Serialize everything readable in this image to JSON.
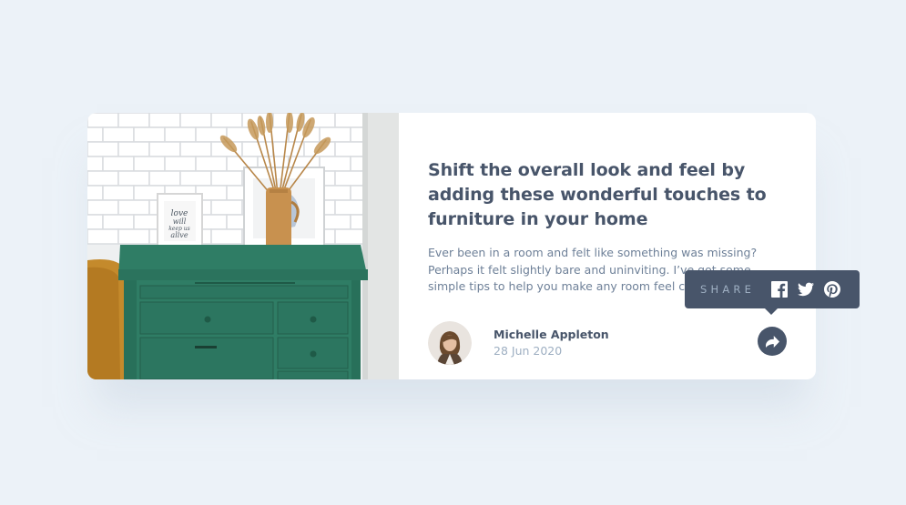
{
  "card": {
    "headline": "Shift the overall look and feel by adding these wonderful touches to furniture in your home",
    "description": "Ever been in a room and felt like something was missing? Perhaps it felt slightly bare and uninviting. I’ve got some simple tips to help you make any room feel complete.",
    "author": {
      "name": "Michelle Appleton",
      "date": "28 Jun 2020"
    },
    "image": {
      "frame_text": [
        "love",
        "will",
        "keep us",
        "alive"
      ]
    }
  },
  "share": {
    "label": "SHARE",
    "icons": [
      "facebook-icon",
      "twitter-icon",
      "pinterest-icon"
    ]
  },
  "colors": {
    "background": "#ecf2f8",
    "headline": "#48556a",
    "body": "#6e8098",
    "muted": "#9eafc2",
    "dark": "#48556a",
    "drawer_green": "#2e7c64"
  }
}
